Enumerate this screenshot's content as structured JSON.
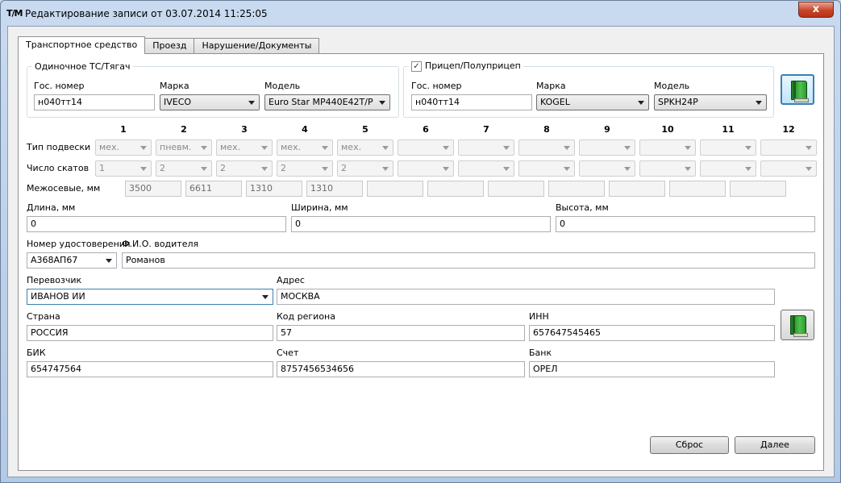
{
  "window": {
    "icon_text": "T/M",
    "title": "Редактирование записи от 03.07.2014 11:25:05",
    "close_label": "x"
  },
  "tabs": [
    {
      "label": "Транспортное средство"
    },
    {
      "label": "Проезд"
    },
    {
      "label": "Нарушение/Документы"
    }
  ],
  "tractor": {
    "group_title": "Одиночное ТС/Тягач",
    "plate_label": "Гос. номер",
    "plate_value": "н040тт14",
    "make_label": "Марка",
    "make_value": "IVECO",
    "model_label": "Модель",
    "model_value": "Euro Star MP440E42T/P"
  },
  "trailer": {
    "checkbox_checked": true,
    "check_mark": "✓",
    "group_title": "Прицеп/Полуприцеп",
    "plate_label": "Гос. номер",
    "plate_value": "н040тт14",
    "make_label": "Марка",
    "make_value": "KOGEL",
    "model_label": "Модель",
    "model_value": "SPKH24P"
  },
  "axles": {
    "columns": [
      "1",
      "2",
      "3",
      "4",
      "5",
      "6",
      "7",
      "8",
      "9",
      "10",
      "11",
      "12"
    ],
    "suspension_label": "Тип подвески",
    "suspension": [
      "мех.",
      "пневм.",
      "мех.",
      "мех.",
      "мех.",
      "",
      "",
      "",
      "",
      "",
      "",
      ""
    ],
    "wheels_label": "Число скатов",
    "wheels": [
      "1",
      "2",
      "2",
      "2",
      "2",
      "",
      "",
      "",
      "",
      "",
      "",
      ""
    ],
    "spacing_label": "Межосевые, мм",
    "spacing": [
      "3500",
      "6611",
      "1310",
      "1310",
      "",
      "",
      "",
      "",
      "",
      "",
      ""
    ]
  },
  "dimensions": {
    "length_label": "Длина, мм",
    "length_value": "0",
    "width_label": "Ширина, мм",
    "width_value": "0",
    "height_label": "Высота, мм",
    "height_value": "0"
  },
  "driver": {
    "license_label": "Номер удостоверения",
    "license_value": "А368АП67",
    "name_label": "Ф.И.О. водителя",
    "name_value": "Романов"
  },
  "carrier": {
    "carrier_label": "Перевозчик",
    "carrier_value": "ИВАНОВ ИИ",
    "address_label": "Адрес",
    "address_value": "МОСКВА",
    "country_label": "Страна",
    "country_value": "РОССИЯ",
    "region_label": "Код региона",
    "region_value": "57",
    "inn_label": "ИНН",
    "inn_value": "657647545465",
    "bik_label": "БИК",
    "bik_value": "654747564",
    "account_label": "Счет",
    "account_value": "8757456534656",
    "bank_label": "Банк",
    "bank_value": "ОРЕЛ"
  },
  "buttons": {
    "reset_label": "Сброс",
    "next_label": "Далее"
  }
}
